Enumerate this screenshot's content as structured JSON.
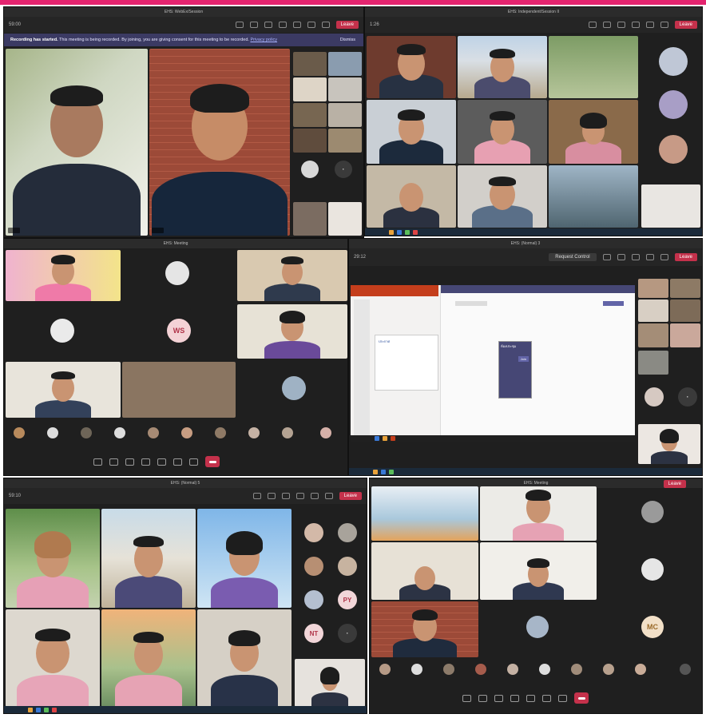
{
  "banner": {
    "title": "Recording has started.",
    "text": "This meeting is being recorded. By joining, you are giving consent for this meeting to be recorded.",
    "link": "Privacy policy",
    "dismiss": "Dismiss"
  },
  "window_titles": {
    "w1": "EHS: WebEx/Session",
    "w2": "EHS: Independent/Session II",
    "w3": "EHS: Meeting",
    "w4": "EHS: (Normal) 3",
    "w5": "EHS: (Normal) 5",
    "w6": "EHS: Meeting"
  },
  "toolbar": {
    "leave_label": "Leave",
    "timer1": "59:00",
    "timer2": "1:26",
    "timer3": "1:25:08",
    "timer4": "29:12",
    "timer5": "59:10",
    "timer6": "1:00:02",
    "request_control": "Request Control"
  },
  "avatars": {
    "ws": "WS",
    "py": "PY",
    "nt": "NT",
    "mc": "MC"
  },
  "slide": {
    "header": "ประกาศ",
    "popup_title": "ห้องประชุม",
    "popup_button": "Join"
  },
  "colors": {
    "accent": "#e4246f",
    "leave": "#c4314b",
    "banner": "#3b3a63",
    "window": "#1f1f1f"
  }
}
